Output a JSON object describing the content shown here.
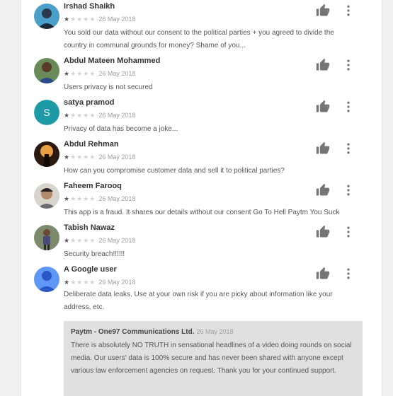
{
  "reviews": [
    {
      "name": "Irshad Shaikh",
      "rating": 1,
      "date": "26 May 2018",
      "text": "You sold our data without our consent to the political parties + you agreed to divide the country in communal grounds for money? Shame of you...",
      "avatar": "photo"
    },
    {
      "name": "Abdul Mateen Mohammed",
      "rating": 1,
      "date": "26 May 2018",
      "text": "Users privacy is not secured",
      "avatar": "photo"
    },
    {
      "name": "satya pramod",
      "rating": 1,
      "date": "26 May 2018",
      "text": "Privacy of data has become a joke...",
      "avatar_letter": "S",
      "avatar_color": "#1e9aa6"
    },
    {
      "name": "Abdul Rehman",
      "rating": 1,
      "date": "26 May 2018",
      "text": "How can you compromise customer data and sell it to political parties?",
      "avatar": "photo"
    },
    {
      "name": "Faheem Farooq",
      "rating": 1,
      "date": "26 May 2018",
      "text": "This app is a fraud. It shares our details without our consent Go To Hell Paytm You Suck",
      "avatar": "photo"
    },
    {
      "name": "Tabish Nawaz",
      "rating": 1,
      "date": "26 May 2018",
      "text": "Security breach!!!!!!",
      "avatar": "photo"
    },
    {
      "name": "A Google user",
      "rating": 1,
      "date": "26 May 2018",
      "text": "Deliberate data leaks. Use at your own risk if you are picky about information like your address, etc.",
      "avatar": "default-user-icon",
      "avatar_color": "#5e97f6"
    }
  ],
  "developer_reply": {
    "author": "Paytm - One97 Communications Ltd.",
    "date": "26 May 2018",
    "text": "There is absolutely NO TRUTH in sensational headlines of a video doing rounds on social media.  Our users' data is 100% secure and has never been shared with anyone except various law enforcement agencies on request.  Thank you for your continued support."
  },
  "icons": {
    "helpful": "thumbs-up-icon",
    "menu": "more-vert-icon"
  },
  "colors": {
    "icon_gray": "#757575",
    "star_filled": "#555555",
    "star_empty": "#d3d3d3",
    "reply_background": "#e0e0e0"
  }
}
